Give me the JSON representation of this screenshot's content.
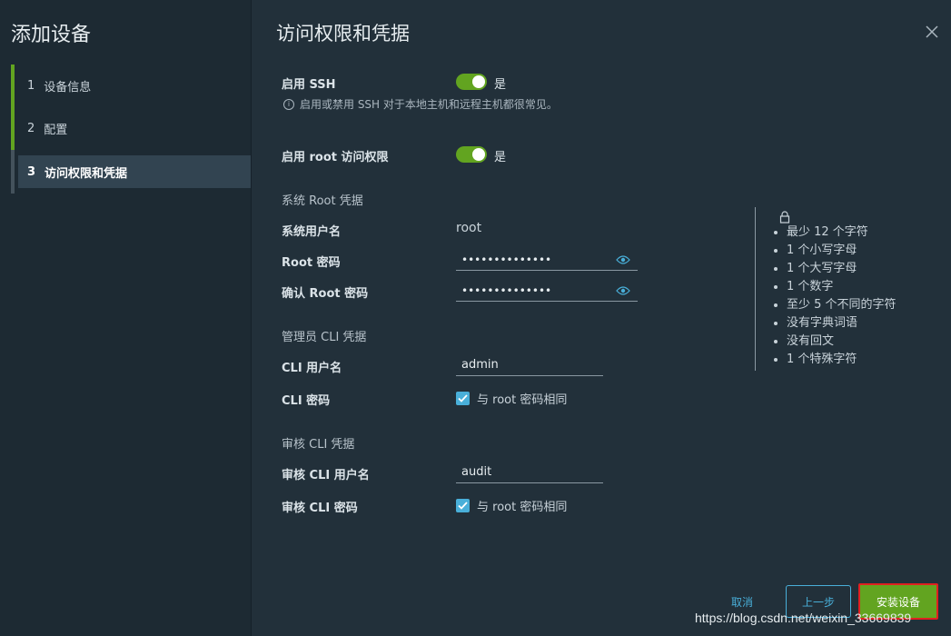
{
  "wizard": {
    "title": "添加设备",
    "steps": [
      {
        "num": "1",
        "label": "设备信息"
      },
      {
        "num": "2",
        "label": "配置"
      },
      {
        "num": "3",
        "label": "访问权限和凭据"
      }
    ]
  },
  "page": {
    "title": "访问权限和凭据",
    "ssh": {
      "label": "启用 SSH",
      "toggle_text": "是",
      "help": "启用或禁用 SSH 对于本地主机和远程主机都很常见。"
    },
    "root_access": {
      "label": "启用 root 访问权限",
      "toggle_text": "是"
    },
    "system_root": {
      "section": "系统 Root 凭据",
      "username_label": "系统用户名",
      "username_value": "root",
      "password_label": "Root 密码",
      "password_value": "••••••••••••••",
      "confirm_label": "确认 Root 密码",
      "confirm_value": "••••••••••••••"
    },
    "admin_cli": {
      "section": "管理员 CLI 凭据",
      "username_label": "CLI 用户名",
      "username_value": "admin",
      "password_label": "CLI 密码",
      "same_as_root": "与 root 密码相同"
    },
    "audit_cli": {
      "section": "审核 CLI 凭据",
      "username_label": "审核 CLI 用户名",
      "username_value": "audit",
      "password_label": "审核 CLI 密码",
      "same_as_root": "与 root 密码相同"
    },
    "password_rules": [
      "最少 12 个字符",
      "1 个小写字母",
      "1 个大写字母",
      "1 个数字",
      "至少 5 个不同的字符",
      "没有字典词语",
      "没有回文",
      "1 个特殊字符"
    ]
  },
  "footer": {
    "cancel": "取消",
    "back": "上一步",
    "install": "安装设备"
  },
  "watermark": "https://blog.csdn.net/weixin_33669839",
  "colors": {
    "accent_green": "#62a420",
    "link_blue": "#49afd9",
    "highlight_red": "#e02020"
  }
}
